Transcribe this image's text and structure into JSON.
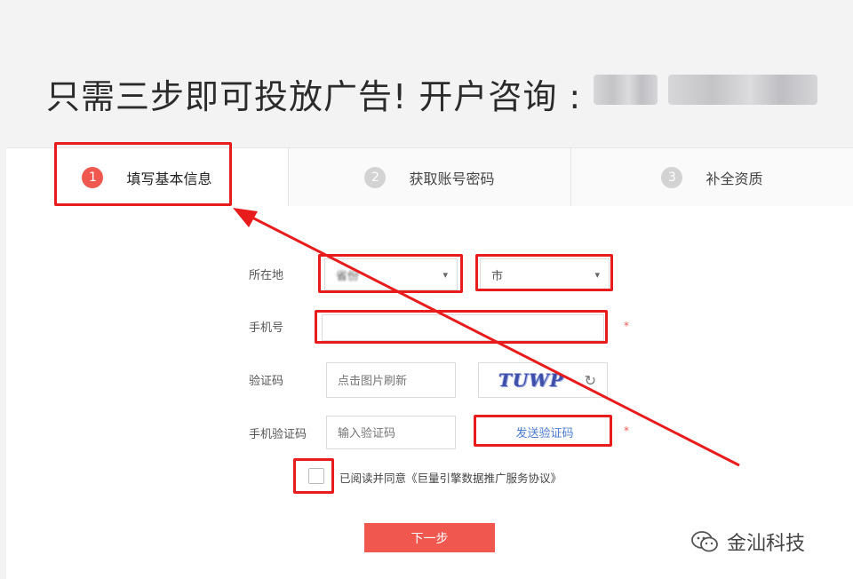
{
  "header": {
    "headline": "只需三步即可投放广告! 开户咨询 :"
  },
  "steps": [
    {
      "num": "1",
      "label": "填写基本信息"
    },
    {
      "num": "2",
      "label": "获取账号密码"
    },
    {
      "num": "3",
      "label": "补全资质"
    }
  ],
  "form": {
    "location_label": "所在地",
    "province_value": "省份",
    "city_value": "市",
    "phone_label": "手机号",
    "phone_value": "",
    "captcha_label": "验证码",
    "captcha_placeholder": "点击图片刷新",
    "captcha_text": "TUWP",
    "sms_label": "手机验证码",
    "sms_placeholder": "输入验证码",
    "send_code_label": "发送验证码",
    "required_mark": "*",
    "agree_text": "已阅读并同意《巨量引擎数据推广服务协议》",
    "next_label": "下一步"
  },
  "icons": {
    "caret": "▾",
    "refresh": "↻"
  },
  "colors": {
    "accent": "#f0584f",
    "highlight": "#e81c1c",
    "link": "#4a7bd0"
  },
  "watermark": {
    "text": "金汕科技"
  }
}
